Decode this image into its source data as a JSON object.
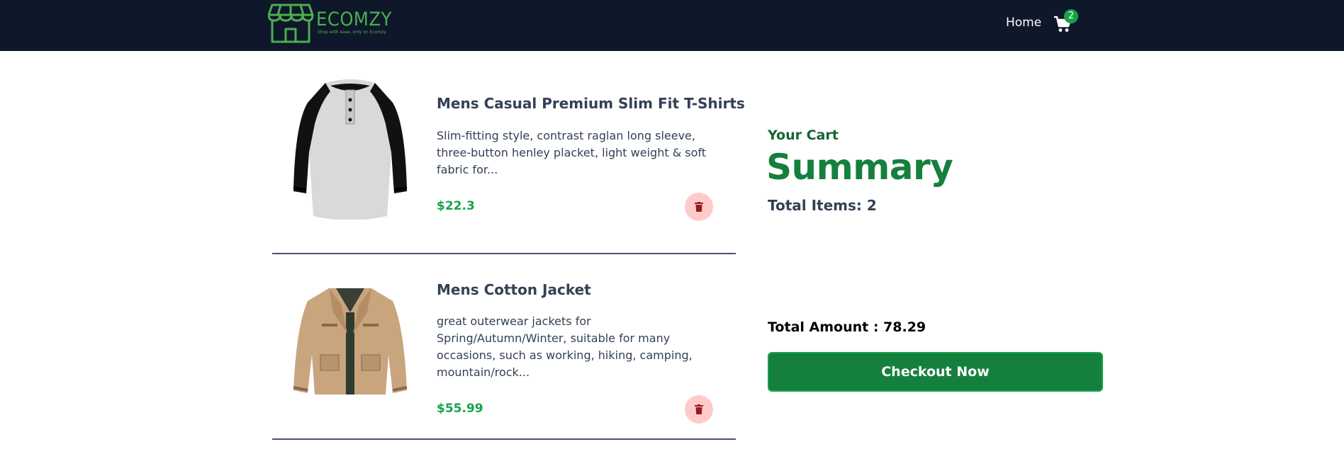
{
  "navbar": {
    "logo_text": "ECOMZY",
    "logo_tagline": "Shop with ease, only on Ecomzy",
    "home_label": "Home",
    "cart_count": "2"
  },
  "cart": {
    "items": [
      {
        "title": "Mens Casual Premium Slim Fit T-Shirts",
        "description": "Slim-fitting style, contrast raglan long sleeve, three-button henley placket, light weight & soft fabric for...",
        "price": "$22.3",
        "image": "raglan-henley-shirt"
      },
      {
        "title": "Mens Cotton Jacket",
        "description": "great outerwear jackets for Spring/Autumn/Winter, suitable for many occasions, such as working, hiking, camping, mountain/rock...",
        "price": "$55.99",
        "image": "tan-cotton-jacket"
      }
    ]
  },
  "summary": {
    "label": "Your Cart",
    "title": "Summary",
    "total_items": "Total Items: 2",
    "total_amount_label": "Total Amount : ",
    "total_amount_value": "78.29",
    "checkout_label": "Checkout Now"
  },
  "colors": {
    "navbar": "#0f172a",
    "accent_green": "#15803d",
    "price_green": "#16a34a",
    "delete_bg": "#fecaca",
    "delete_icon": "#991b1b"
  },
  "icons": {
    "logo": "storefront-icon",
    "cart": "shopping-cart-icon",
    "delete": "trash-icon"
  }
}
